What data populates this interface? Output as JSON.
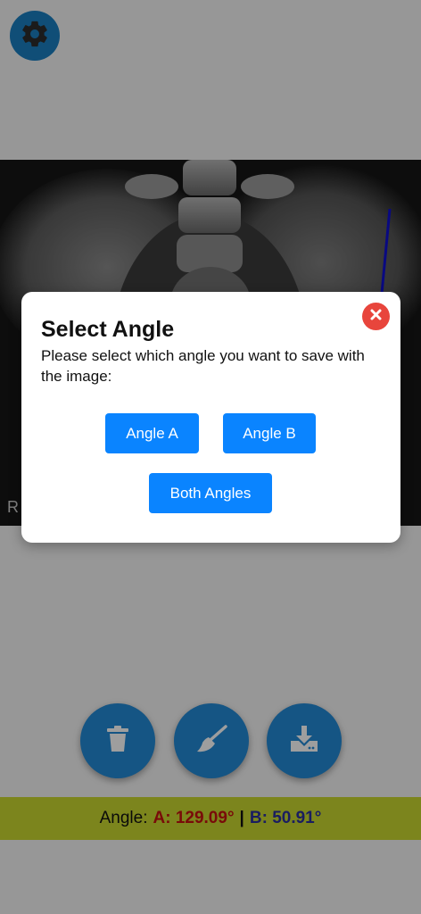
{
  "icons": {
    "settings": "gear-icon",
    "close": "close-icon",
    "delete": "trash-icon",
    "clear": "broom-icon",
    "save": "download-icon"
  },
  "colors": {
    "fab": "#2389d6",
    "bar": "#c8d730",
    "angle_a": "#c4120f",
    "angle_b": "#2a2f9c",
    "button": "#0a84ff",
    "close": "#e8453c"
  },
  "dialog": {
    "title": "Select Angle",
    "message": "Please select which angle you want to save with the image:",
    "angle_a_label": "Angle A",
    "angle_b_label": "Angle B",
    "both_label": "Both Angles"
  },
  "angles": {
    "label": "Angle:",
    "a_text": "A: 129.09°",
    "separator": "|",
    "b_text": "B: 50.91°"
  }
}
